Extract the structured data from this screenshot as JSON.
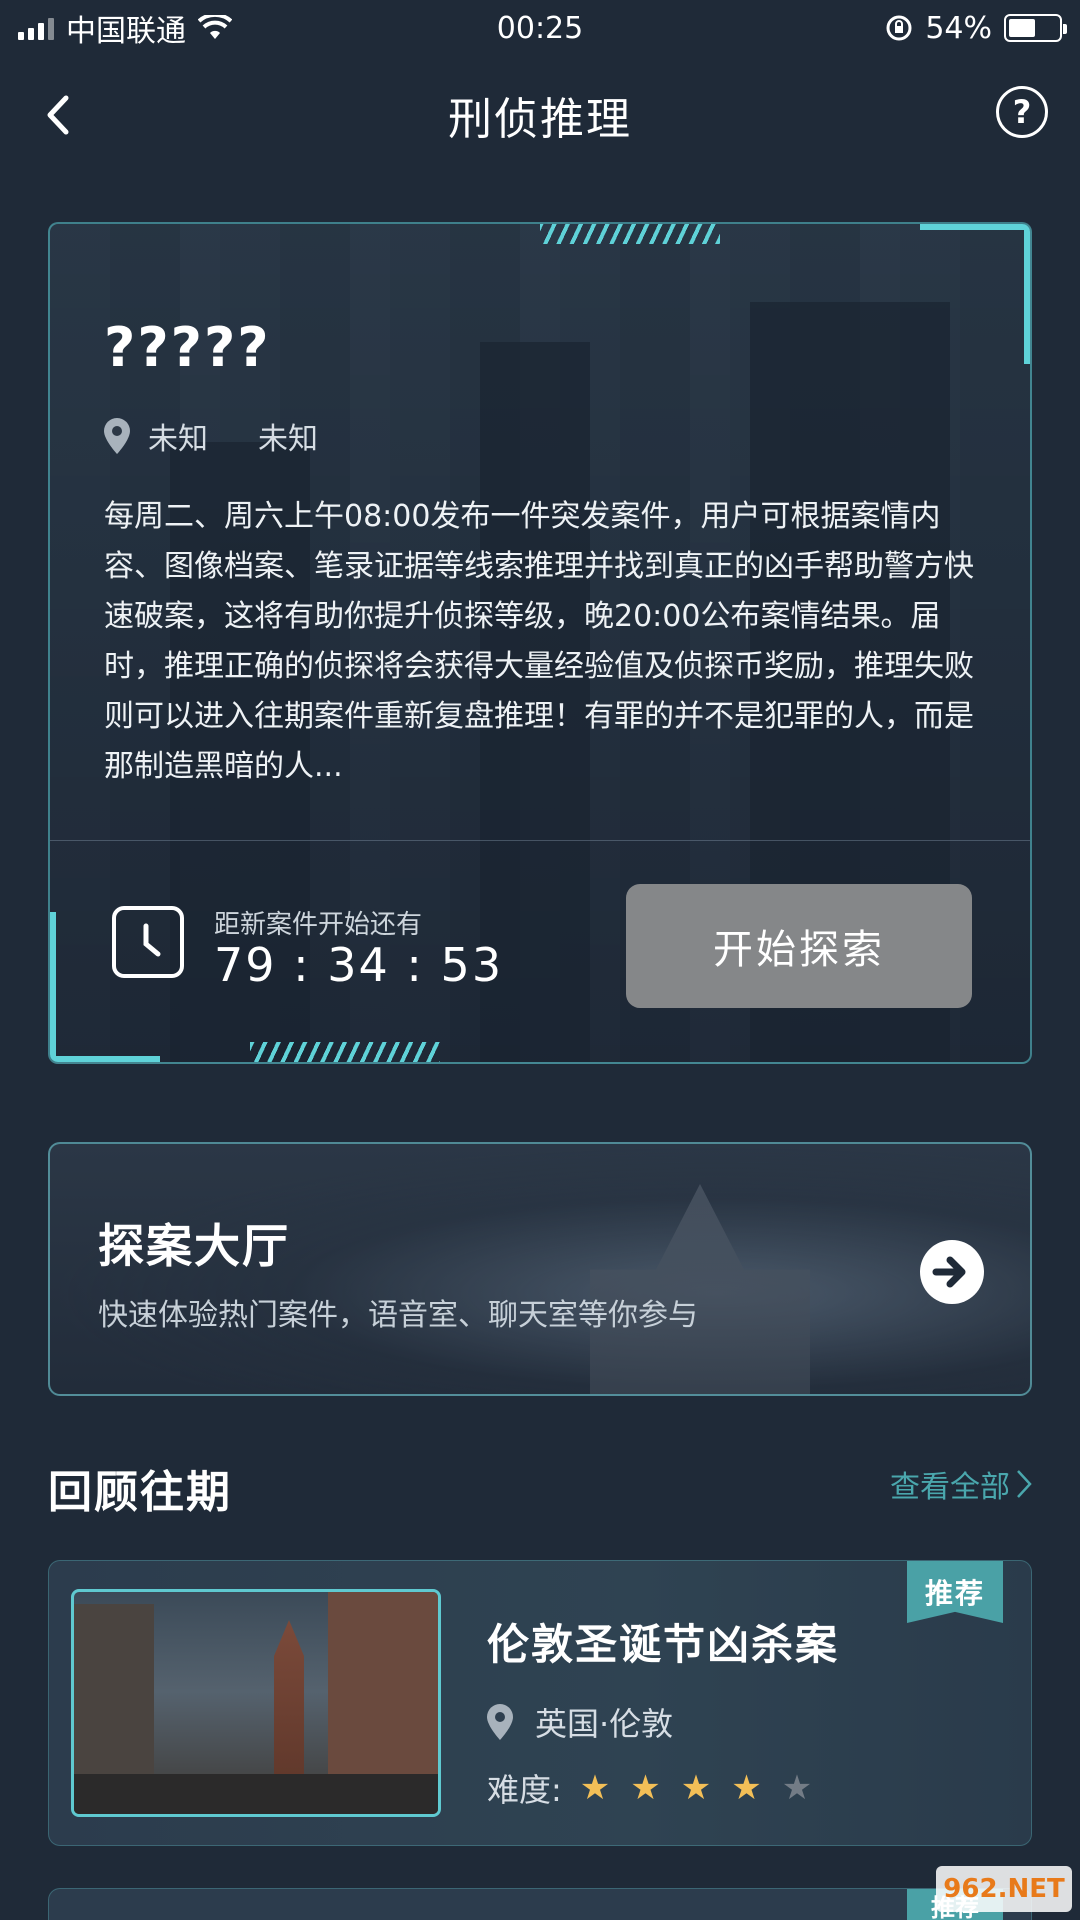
{
  "status_bar": {
    "carrier": "中国联通",
    "time": "00:25",
    "battery_percent": "54%",
    "battery_level": 0.54,
    "icons": [
      "signal-icon",
      "wifi-icon",
      "rotation-lock-icon",
      "battery-icon"
    ]
  },
  "nav": {
    "title": "刑侦推理",
    "back_icon": "chevron-left-icon",
    "help_label": "?"
  },
  "case_card": {
    "title": "?????",
    "location": [
      "未知",
      "未知"
    ],
    "description": "每周二、周六上午08:00发布一件突发案件，用户可根据案情内容、图像档案、笔录证据等线索推理并找到真正的凶手帮助警方快速破案，这将有助你提升侦探等级，晚20:00公布案情结果。届时，推理正确的侦探将会获得大量经验值及侦探币奖励，推理失败则可以进入往期案件重新复盘推理！有罪的并不是犯罪的人，而是那制造黑暗的人...",
    "countdown_label": "距新案件开始还有",
    "countdown_value": "79 : 34 : 53",
    "start_button": "开始探索"
  },
  "hall": {
    "title": "探案大厅",
    "subtitle": "快速体验热门案件，语音室、聊天室等你参与"
  },
  "past_section": {
    "title": "回顾往期",
    "view_all": "查看全部",
    "items": [
      {
        "badge": "推荐",
        "title": "伦敦圣诞节凶杀案",
        "location": "英国·伦敦",
        "difficulty_label": "难度:",
        "difficulty_stars": 4,
        "difficulty_max": 5
      }
    ],
    "next_badge": "推荐"
  },
  "watermark": "962.NET",
  "colors": {
    "background": "#1f2a38",
    "accent_cyan": "#5fd2d8",
    "badge": "#4aa1a6",
    "star": "#f3bf57",
    "button_gray": "#858789"
  }
}
